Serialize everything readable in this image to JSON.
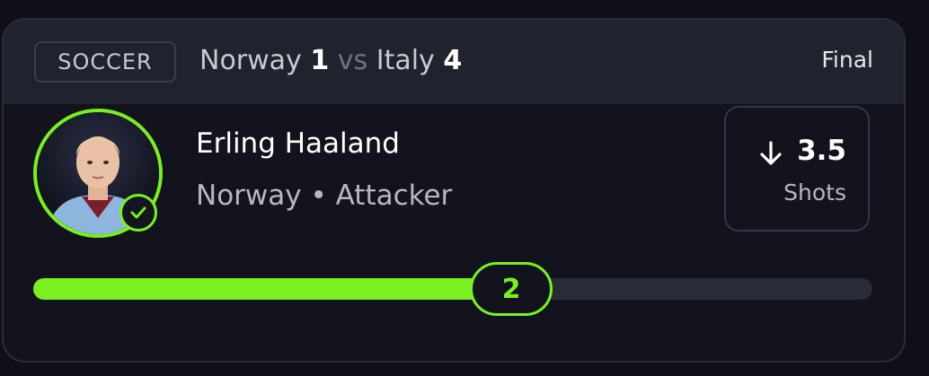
{
  "header": {
    "sport": "SOCCER",
    "home_team": "Norway",
    "home_score": "1",
    "vs_label": "vs",
    "away_team": "Italy",
    "away_score": "4",
    "status": "Final"
  },
  "player": {
    "name": "Erling Haaland",
    "team": "Norway",
    "separator": "•",
    "position": "Attacker",
    "verified_icon": "check-circle-icon"
  },
  "line": {
    "direction_icon": "arrow-down-icon",
    "value": "3.5",
    "stat": "Shots"
  },
  "progress": {
    "actual_value": "2",
    "fill_fraction": 0.57
  },
  "colors": {
    "accent": "#7aef22",
    "background": "#0e0f17",
    "card": "#12131d",
    "header": "#20222e"
  }
}
